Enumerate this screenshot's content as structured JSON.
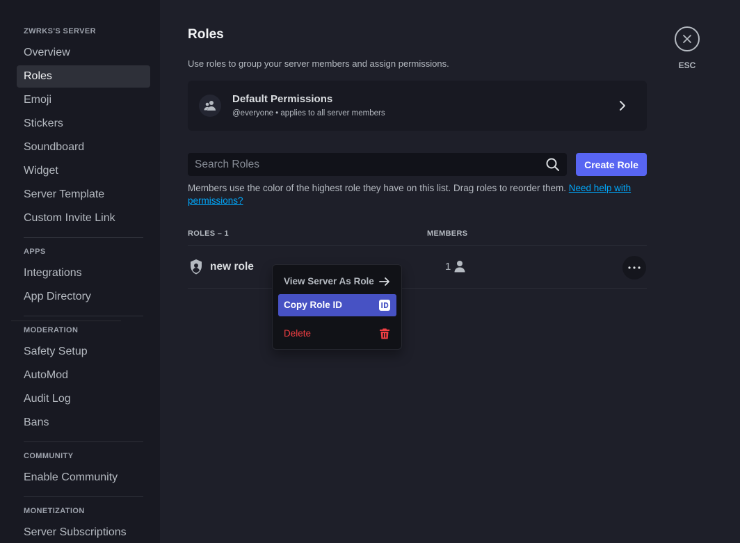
{
  "sidebar": {
    "server_header": "ZWRKS'S SERVER",
    "server_items": [
      {
        "label": "Overview"
      },
      {
        "label": "Roles"
      },
      {
        "label": "Emoji"
      },
      {
        "label": "Stickers"
      },
      {
        "label": "Soundboard"
      },
      {
        "label": "Widget"
      },
      {
        "label": "Server Template"
      },
      {
        "label": "Custom Invite Link"
      }
    ],
    "active_item": "Roles",
    "apps_header": "APPS",
    "apps_items": [
      {
        "label": "Integrations"
      },
      {
        "label": "App Directory"
      }
    ],
    "moderation_header": "MODERATION",
    "moderation_items": [
      {
        "label": "Safety Setup"
      },
      {
        "label": "AutoMod"
      },
      {
        "label": "Audit Log"
      },
      {
        "label": "Bans"
      }
    ],
    "community_header": "COMMUNITY",
    "community_items": [
      {
        "label": "Enable Community"
      }
    ],
    "monetization_header": "MONETIZATION",
    "monetization_items": [
      {
        "label": "Server Subscriptions"
      }
    ]
  },
  "main": {
    "title": "Roles",
    "description": "Use roles to group your server members and assign permissions.",
    "default_permissions": {
      "title": "Default Permissions",
      "subtitle": "@everyone • applies to all server members",
      "icon": "members-icon"
    },
    "search": {
      "placeholder": "Search Roles",
      "value": ""
    },
    "create_role_label": "Create Role",
    "help_text": "Members use the color of the highest role they have on this list. Drag roles to reorder them.",
    "help_link": "Need help with permissions?",
    "columns": {
      "roles": "ROLES – 1",
      "members": "MEMBERS"
    },
    "roles": [
      {
        "name": "new role",
        "members": "1",
        "icon": "shield-icon"
      }
    ]
  },
  "context_menu": {
    "items": [
      {
        "label": "View Server As Role",
        "icon": "arrow-right-icon"
      },
      {
        "label": "Copy Role ID",
        "icon": "id-icon",
        "highlighted": true
      },
      {
        "label": "Delete",
        "icon": "trash-icon",
        "danger": true
      }
    ]
  },
  "close": {
    "label": "ESC"
  },
  "colors": {
    "accent": "#5865f2",
    "highlight": "#4752c4",
    "danger": "#f23f43",
    "link": "#00a8fc",
    "background": "#1e1f29",
    "sidebar": "#181922"
  }
}
